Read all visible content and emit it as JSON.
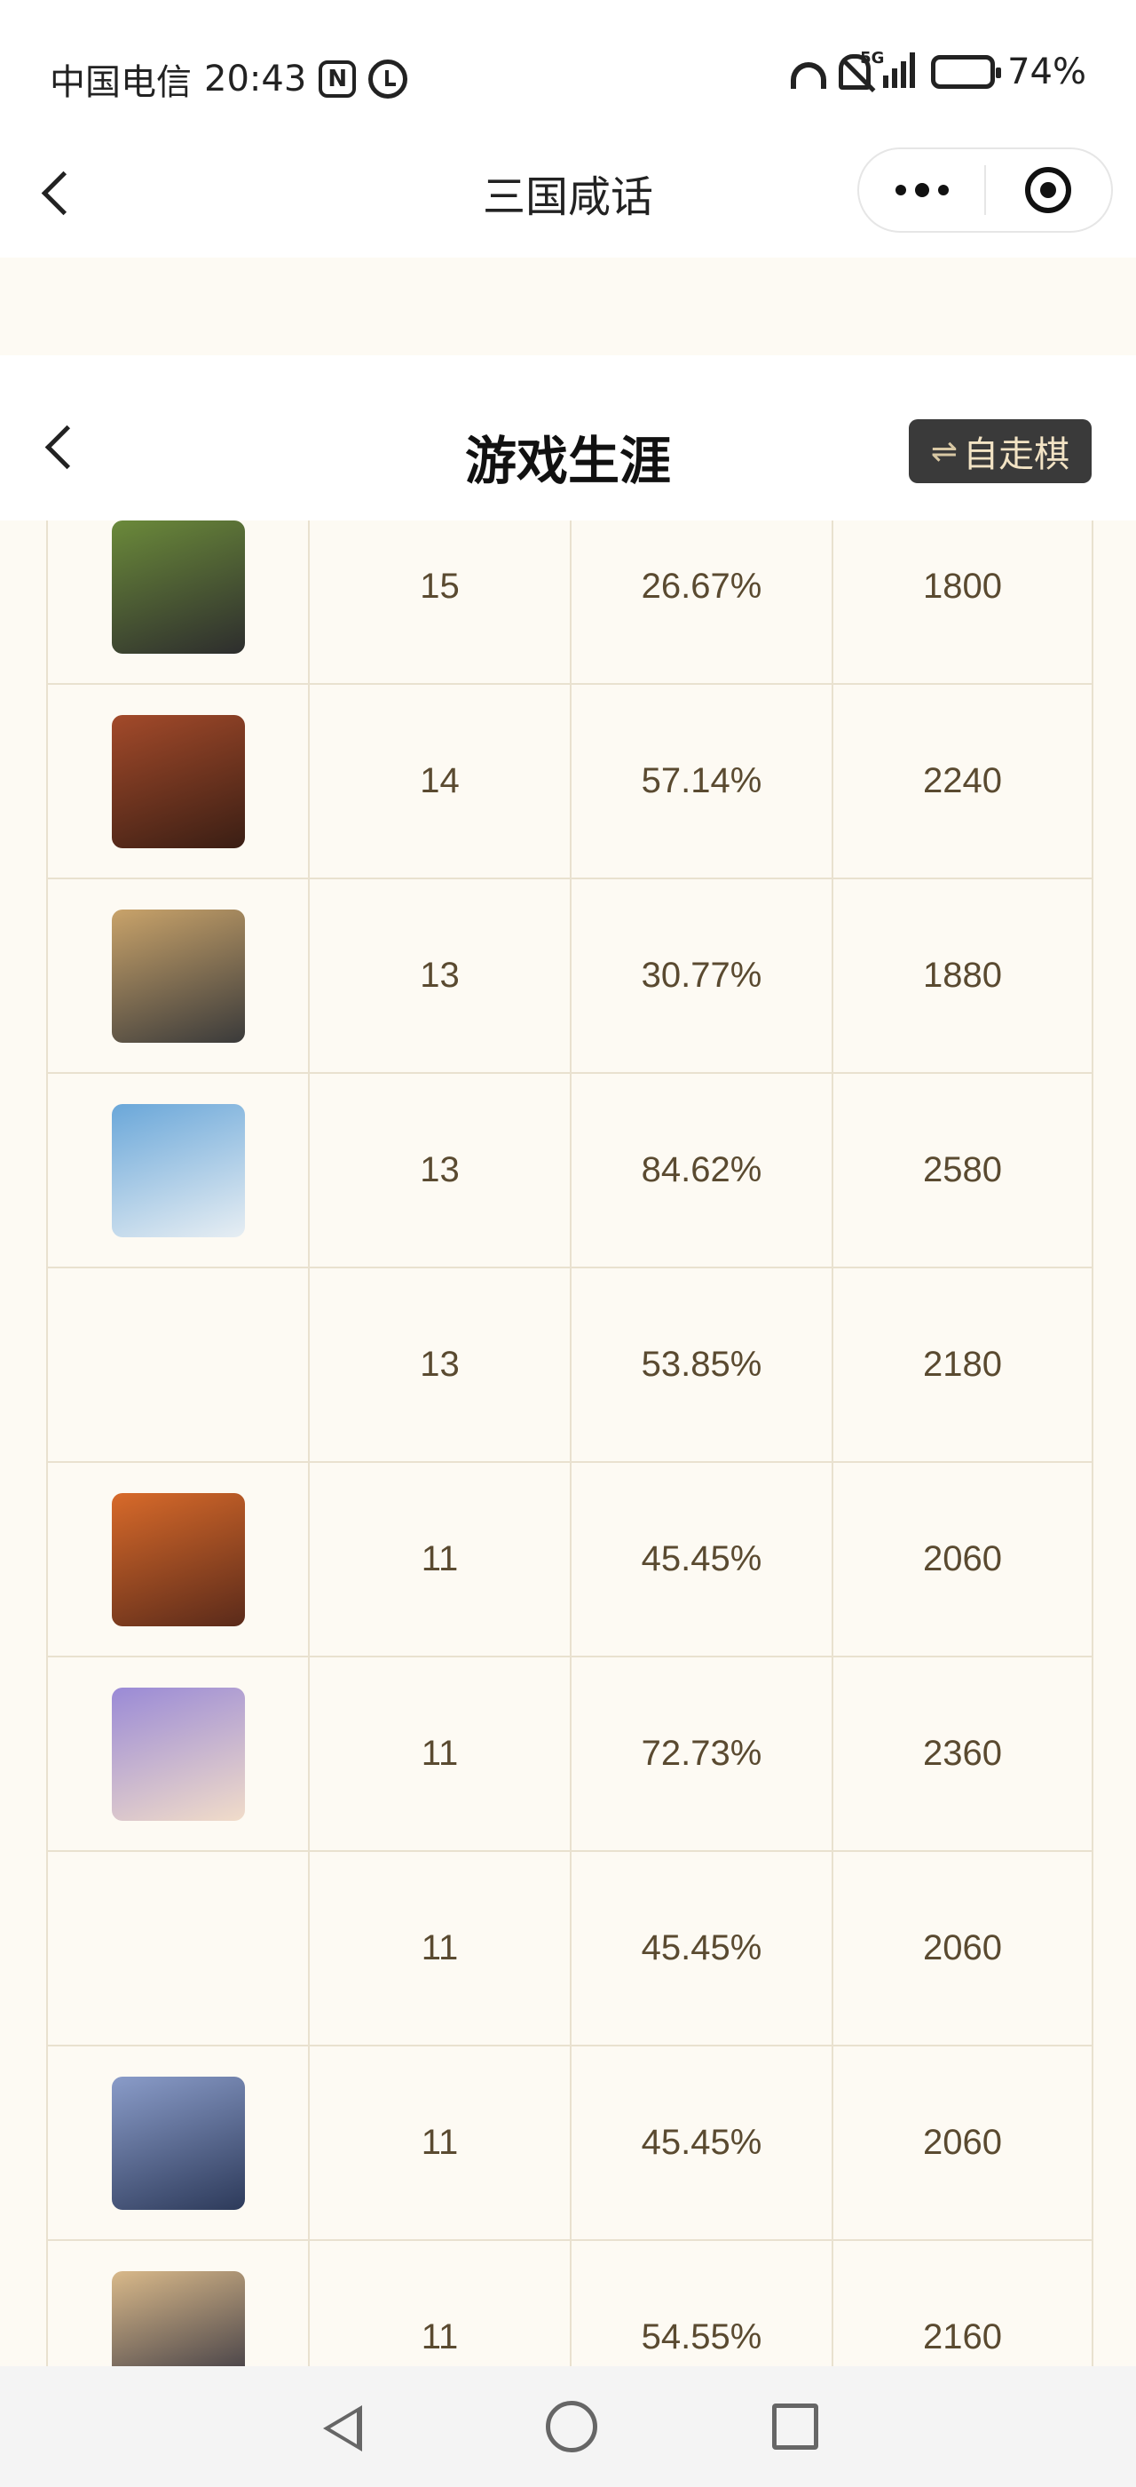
{
  "status_bar": {
    "carrier": "中国电信",
    "time": "20:43",
    "nfc_icon": "nfc-icon",
    "alarm_icon": "alarm-icon",
    "network": "5G",
    "battery_percent": "74%",
    "battery_level": 0.74
  },
  "mini_program": {
    "title": "三国咸话",
    "more_icon": "more-dots-icon",
    "close_icon": "target-close-icon"
  },
  "page": {
    "title": "游戏生涯",
    "mode_button_icon": "⇌",
    "mode_button_label": "自走棋"
  },
  "table": {
    "rows": [
      {
        "avatar": "hero-1",
        "games": "15",
        "win_rate": "26.67%",
        "score": "1800",
        "colors": [
          "#6b8a3a",
          "#2d2d2d"
        ]
      },
      {
        "avatar": "hero-2",
        "games": "14",
        "win_rate": "57.14%",
        "score": "2240",
        "colors": [
          "#a34a2a",
          "#3a1e14"
        ]
      },
      {
        "avatar": "hero-3",
        "games": "13",
        "win_rate": "30.77%",
        "score": "1880",
        "colors": [
          "#c9a36a",
          "#3a3a3a"
        ]
      },
      {
        "avatar": "hero-4",
        "games": "13",
        "win_rate": "84.62%",
        "score": "2580",
        "colors": [
          "#6aa7d9",
          "#e7eef3"
        ]
      },
      {
        "avatar": "",
        "games": "13",
        "win_rate": "53.85%",
        "score": "2180",
        "colors": []
      },
      {
        "avatar": "hero-6",
        "games": "11",
        "win_rate": "45.45%",
        "score": "2060",
        "colors": [
          "#d86a2a",
          "#5a2a1a"
        ]
      },
      {
        "avatar": "hero-7",
        "games": "11",
        "win_rate": "72.73%",
        "score": "2360",
        "colors": [
          "#9a8ad6",
          "#f1dcc9"
        ]
      },
      {
        "avatar": "",
        "games": "11",
        "win_rate": "45.45%",
        "score": "2060",
        "colors": []
      },
      {
        "avatar": "hero-9",
        "games": "11",
        "win_rate": "45.45%",
        "score": "2060",
        "colors": [
          "#8a9cc9",
          "#2d3a5a"
        ]
      },
      {
        "avatar": "hero-10",
        "games": "11",
        "win_rate": "54.55%",
        "score": "2160",
        "colors": [
          "#d9b98a",
          "#2a2a3a"
        ]
      }
    ]
  },
  "nav_bar": {
    "back_icon": "triangle-back-icon",
    "home_icon": "circle-home-icon",
    "recent_icon": "square-recent-icon"
  }
}
